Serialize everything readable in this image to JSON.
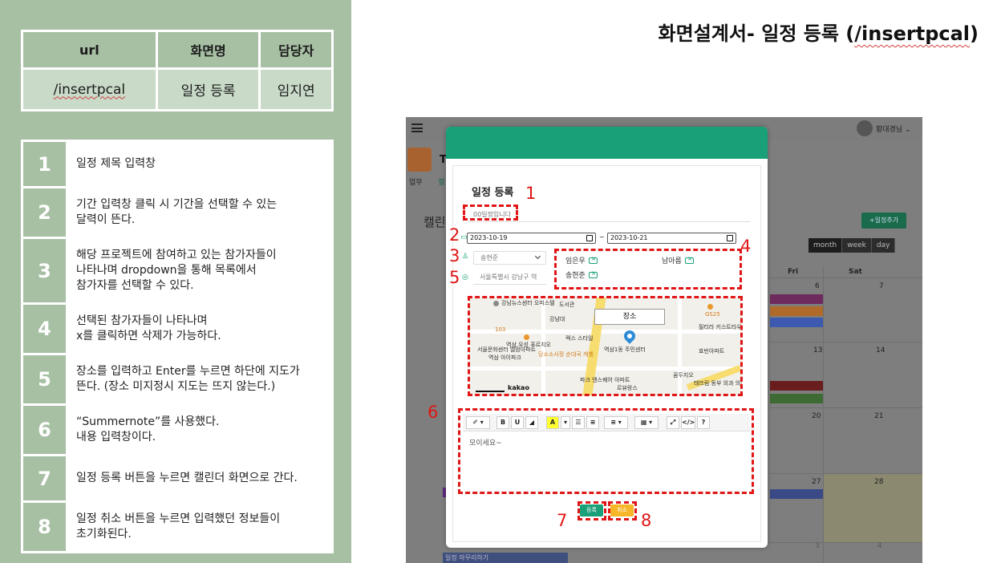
{
  "meta_table": {
    "headers": [
      "url",
      "화면명",
      "담당자"
    ],
    "values": [
      "/insertpcal",
      "일정 등록",
      "임지연"
    ]
  },
  "steps": [
    {
      "num": "1",
      "desc": "일정 제목 입력창"
    },
    {
      "num": "2",
      "desc": "기간 입력창 클릭 시 기간을 선택할 수 있는\n달력이 뜬다."
    },
    {
      "num": "3",
      "desc": "해당 프로젝트에 참여하고 있는 참가자들이\n나타나며 dropdown을 통해 목록에서\n참가자를 선택할 수 있다."
    },
    {
      "num": "4",
      "desc": "선택된 참가자들이 나타나며\nx를 클릭하면 삭제가 가능하다."
    },
    {
      "num": "5",
      "desc": "장소를 입력하고 Enter를 누르면 하단에 지도가\n뜬다. (장소 미지정시 지도는 뜨지 않는다.)"
    },
    {
      "num": "6",
      "desc": "“Summernote”를 사용했다.\n내용 입력창이다."
    },
    {
      "num": "7",
      "desc": "일정 등록 버튼을 누르면 캘린더 화면으로 간다."
    },
    {
      "num": "8",
      "desc": "일정 취소 버튼을 누르면 입력했던 정보들이\n초기화된다."
    }
  ],
  "doc_title": {
    "prefix": "화면설계서- 일정 등록 (",
    "path": "/insertpcal",
    "suffix": ")"
  },
  "background_app": {
    "user_name": "황대경님 ⌄",
    "project_initial": "T",
    "tab_1": "업무",
    "tab_2": "캘",
    "calendar_label": "캘린",
    "add_button": "+일정추가",
    "views": [
      "month",
      "week",
      "day"
    ],
    "col_fri": "Fri",
    "col_sat": "Sat",
    "day_numbers": [
      "6",
      "7",
      "13",
      "14",
      "20",
      "21",
      "27",
      "28",
      "3",
      "4"
    ],
    "bottom_button": "일정 마무리하기"
  },
  "modal": {
    "title": "일정 등록",
    "title_placeholder": "00일정입니다",
    "date_start": "2023-10-19",
    "date_sep": "~",
    "date_end": "2023-10-21",
    "participant_select": "송현준",
    "place_placeholder": "서울특별시 강남구 역",
    "participants": [
      "임은우",
      "남아름",
      "송현준"
    ],
    "map": {
      "tooltip": "장소",
      "attribution": "kakao",
      "labels": [
        "강남뉴스센터 오피스텔",
        "도서관",
        "강남대 ",
        "역삼 우성 푸르지오",
        "렉스 스타일",
        "역삼1동 주민센터",
        "당소소사정 순대국 캐쳉",
        "필티라 키스트타우스",
        "GS25",
        "역삼 아이파크",
        "파크 앤스퀘어 아파트",
        "효빈아파트",
        "서울문화센터 엘팜아파트",
        "르뷰랑스",
        "꿈두지오",
        "태뜨림 동부 외과 의원",
        "103"
      ]
    },
    "editor_content": "모이세요~",
    "register_button": "등록",
    "cancel_button": "취소"
  },
  "annotations": [
    "1",
    "2",
    "3",
    "4",
    "5",
    "6",
    "7",
    "8"
  ],
  "colors": {
    "panel_green": "#a7c0a4",
    "modal_header": "#19a078",
    "annotation_red": "#e01515",
    "cancel_yellow": "#f6b627"
  }
}
